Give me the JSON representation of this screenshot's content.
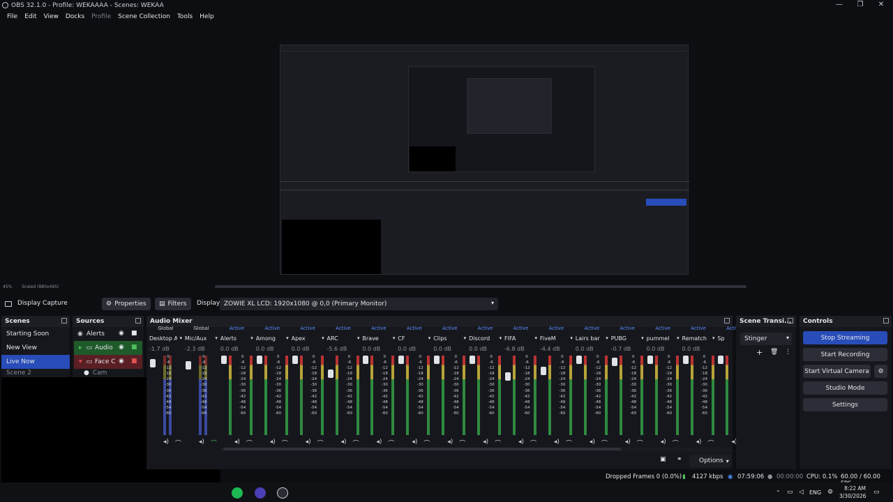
{
  "window": {
    "title": "OBS 32.1.0 - Profile: WEKAAAA - Scenes: WEKAA",
    "minimize": "—",
    "maximize": "❐",
    "close": "✕"
  },
  "menu": [
    "File",
    "Edit",
    "View",
    "Docks",
    "Profile",
    "Scene Collection",
    "Tools",
    "Help"
  ],
  "preview": {
    "zoom_info_left": "45%",
    "zoom_info_right": "Scaled (880x495)"
  },
  "source_toolbar": {
    "source_name": "Display Capture",
    "properties": "Properties",
    "filters": "Filters",
    "display_label": "Display",
    "display_value": "ZOWIE XL LCD: 1920x1080 @ 0,0 (Primary Monitor)"
  },
  "scenes": {
    "title": "Scenes",
    "items": [
      "Starting Soon",
      "New View",
      "Live Now",
      "Scene 2"
    ],
    "selected": "Live Now"
  },
  "sources": {
    "title": "Sources",
    "items": [
      {
        "name": "Alerts"
      },
      {
        "name": "Audio"
      },
      {
        "name": "Face C"
      },
      {
        "name": "Cam"
      }
    ]
  },
  "mixer": {
    "title": "Audio Mixer",
    "channels": [
      {
        "status": "Global",
        "name": "Desktop Audio",
        "db": "-1.7 dB",
        "level": 0.05
      },
      {
        "status": "Global",
        "name": "Mic/Aux",
        "db": "-2.3 dB",
        "level": 0.08
      },
      {
        "status": "Active",
        "name": "Alerts",
        "db": "0.0 dB",
        "level": 0.0
      },
      {
        "status": "Active",
        "name": "Among",
        "db": "0.0 dB",
        "level": 0.0
      },
      {
        "status": "Active",
        "name": "Apex",
        "db": "0.0 dB",
        "level": 0.0
      },
      {
        "status": "Active",
        "name": "ARC",
        "db": "-5.6 dB",
        "level": 0.2
      },
      {
        "status": "Active",
        "name": "Brave",
        "db": "0.0 dB",
        "level": 0.0
      },
      {
        "status": "Active",
        "name": "CF",
        "db": "0.0 dB",
        "level": 0.0
      },
      {
        "status": "Active",
        "name": "Clips",
        "db": "0.0 dB",
        "level": 0.0
      },
      {
        "status": "Active",
        "name": "Discord",
        "db": "0.0 dB",
        "level": 0.0
      },
      {
        "status": "Active",
        "name": "FIFA",
        "db": "-6.8 dB",
        "level": 0.24
      },
      {
        "status": "Active",
        "name": "FiveM",
        "db": "-4.4 dB",
        "level": 0.16
      },
      {
        "status": "Active",
        "name": "Lairs bar",
        "db": "0.0 dB",
        "level": 0.0
      },
      {
        "status": "Active",
        "name": "PUBG",
        "db": "-0.7 dB",
        "level": 0.03
      },
      {
        "status": "Active",
        "name": "pummel",
        "db": "0.0 dB",
        "level": 0.0
      },
      {
        "status": "Active",
        "name": "Rematch",
        "db": "0.0 dB",
        "level": 0.0
      },
      {
        "status": "Active",
        "name": "Sp",
        "db": "",
        "level": 0.0
      }
    ],
    "ticks": [
      "0",
      "-6",
      "-12",
      "-18",
      "-24",
      "-30",
      "-36",
      "-42",
      "-48",
      "-54",
      "-60"
    ],
    "options": "Options"
  },
  "transitions": {
    "title": "Scene Transi...",
    "value": "Stinger"
  },
  "controls": {
    "title": "Controls",
    "buttons": [
      "Stop Streaming",
      "Start Recording",
      "Start Virtual Camera",
      "Studio Mode",
      "Settings"
    ]
  },
  "status": {
    "dropped": "Dropped Frames 0 (0.0%)",
    "bitrate": "4127 kbps",
    "stream_time": "07:59:06",
    "rec_time": "00:00:00",
    "cpu": "CPU: 0.1%",
    "fps": "60.00 / 60.00 FPS"
  },
  "taskbar": {
    "lang": "ENG",
    "time": "8:22 AM",
    "date": "3/30/2026"
  }
}
